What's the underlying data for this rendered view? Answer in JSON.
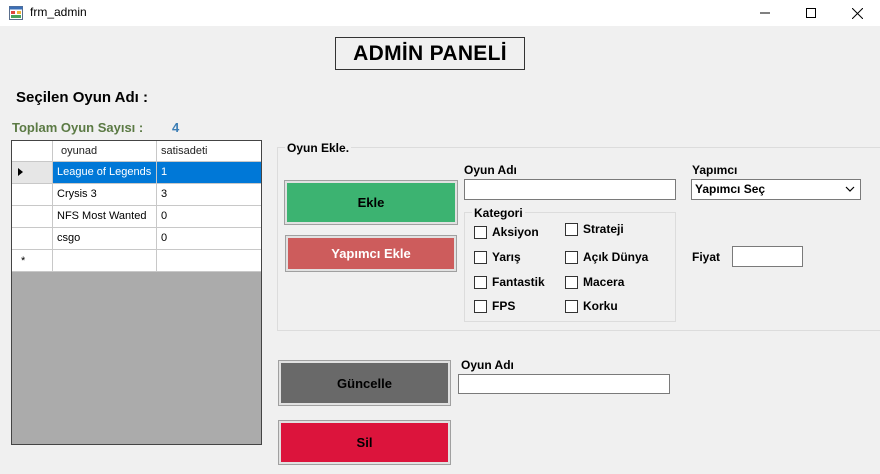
{
  "window": {
    "title": "frm_admin",
    "minimize_glyph": "—",
    "maximize_glyph": "☐",
    "close_glyph": "✕"
  },
  "heading": "ADMİN PANELİ",
  "selected_game": {
    "label": "Seçilen Oyun Adı :"
  },
  "total_games": {
    "label": "Toplam Oyun Sayısı :",
    "value": "4"
  },
  "grid": {
    "columns": [
      "oyunad",
      "satisadeti"
    ],
    "rows": [
      {
        "oyunad": "League of Legends",
        "satisadeti": "1",
        "selected": true
      },
      {
        "oyunad": "Crysis 3",
        "satisadeti": "3",
        "selected": false
      },
      {
        "oyunad": "NFS Most Wanted",
        "satisadeti": "0",
        "selected": false
      },
      {
        "oyunad": "csgo",
        "satisadeti": "0",
        "selected": false
      }
    ],
    "new_row_marker": "*"
  },
  "add_group": {
    "title": "Oyun Ekle.",
    "ekle_button": "Ekle",
    "yapimci_ekle_button": "Yapımcı Ekle",
    "oyun_adi_label": "Oyun Adı",
    "oyun_adi_value": "",
    "yapimci_label": "Yapımcı",
    "yapimci_selected": "Yapımcı Seç",
    "fiyat_label": "Fiyat",
    "fiyat_value": "",
    "kategori": {
      "title": "Kategori",
      "items": [
        {
          "label": "Aksiyon",
          "checked": false
        },
        {
          "label": "Strateji",
          "checked": false
        },
        {
          "label": "Yarış",
          "checked": false
        },
        {
          "label": "Açık Dünya",
          "checked": false
        },
        {
          "label": "Fantastik",
          "checked": false
        },
        {
          "label": "Macera",
          "checked": false
        },
        {
          "label": "FPS",
          "checked": false
        },
        {
          "label": "Korku",
          "checked": false
        }
      ]
    }
  },
  "update": {
    "guncelle_button": "Güncelle",
    "oyun_adi_label": "Oyun Adı",
    "oyun_adi_value": "",
    "sil_button": "Sil"
  },
  "colors": {
    "ekle": "#3cb371",
    "yapimci_ekle": "#cd5c5c",
    "guncelle": "#696969",
    "sil": "#dc143c",
    "selection": "#0078d7",
    "total_label": "#5b7a44",
    "total_value": "#3d7eb5"
  },
  "icons": {
    "app": "form-icon",
    "row_marker": "row-pointer-icon",
    "combo_arrow": "chevron-down-icon"
  }
}
